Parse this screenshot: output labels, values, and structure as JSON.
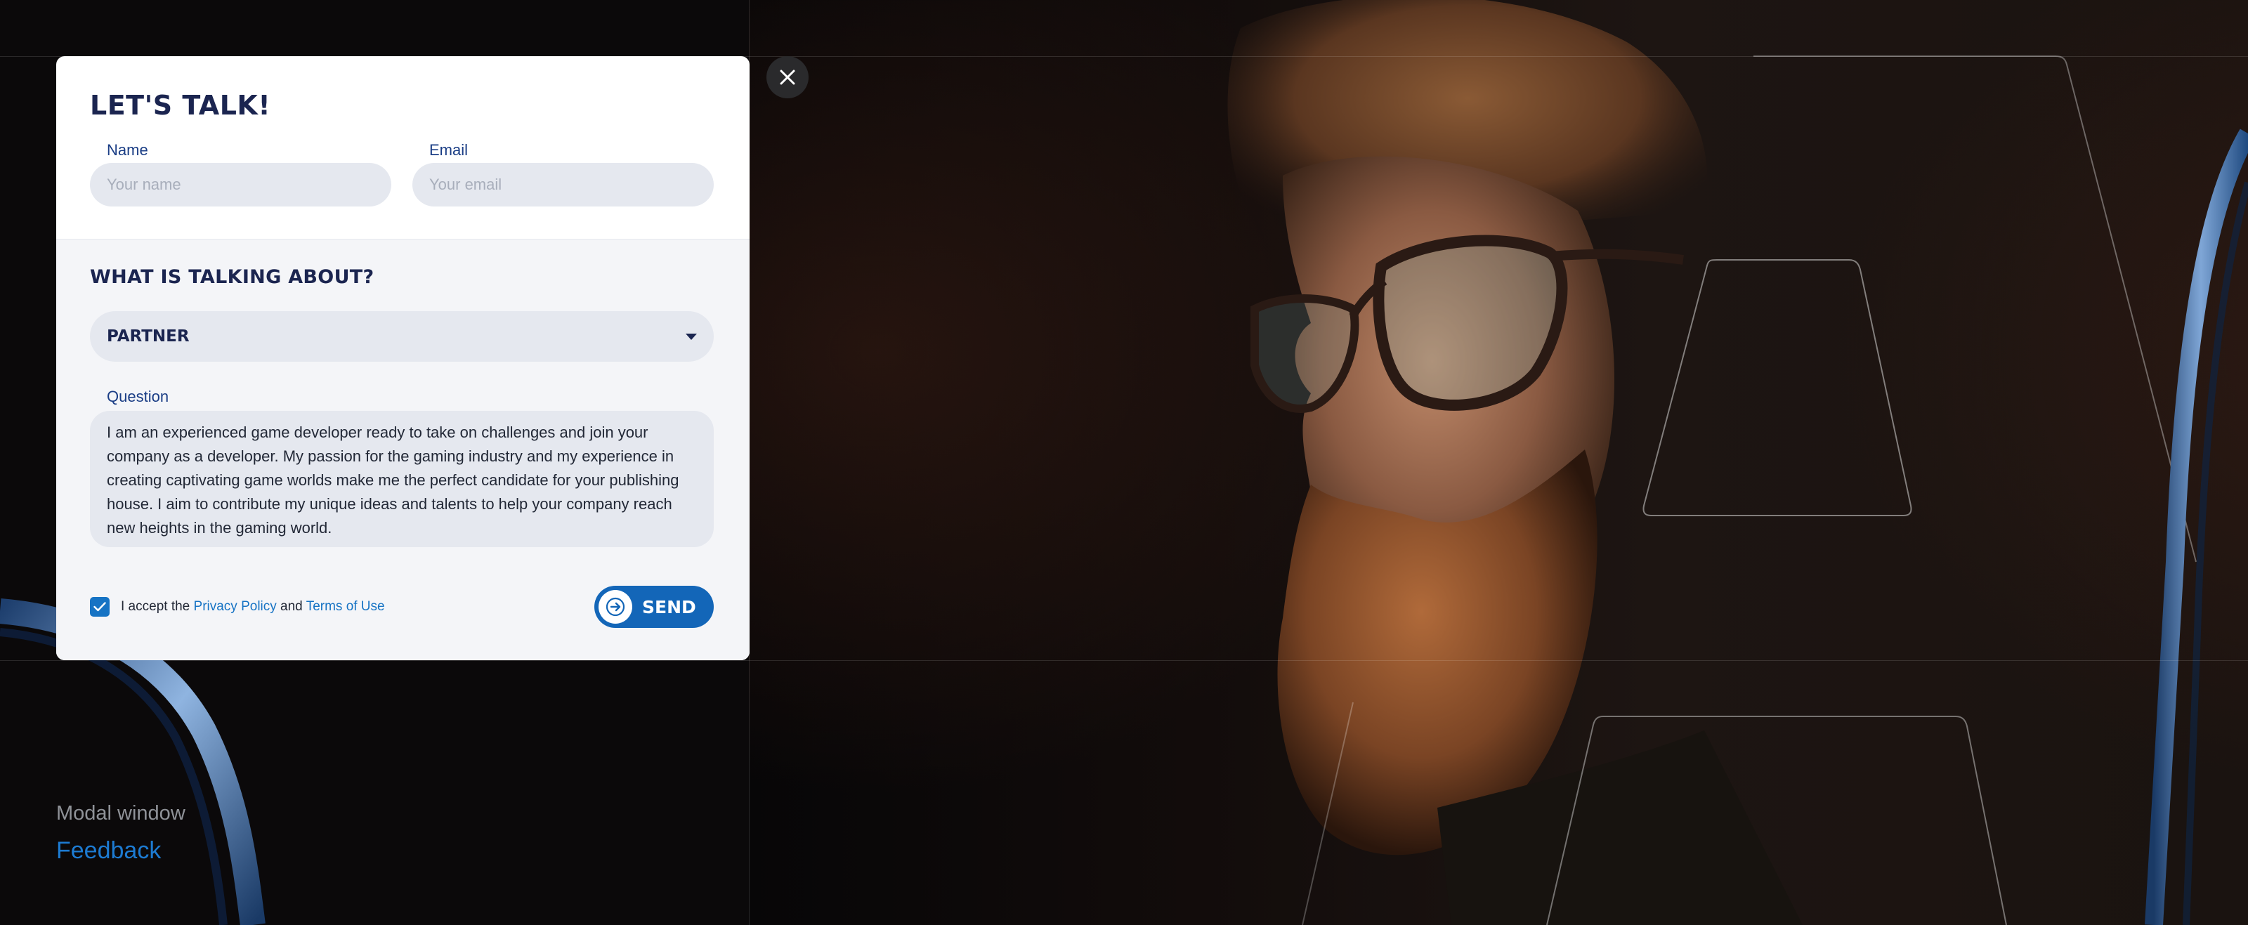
{
  "modal": {
    "title": "LET'S TALK!",
    "name_field": {
      "label": "Name",
      "placeholder": "Your name",
      "value": ""
    },
    "email_field": {
      "label": "Email",
      "placeholder": "Your email",
      "value": ""
    },
    "topic_heading": "WHAT IS TALKING ABOUT?",
    "topic_select": {
      "selected": "PARTNER"
    },
    "question_field": {
      "label": "Question",
      "value": "I am an experienced game developer ready to take on challenges and join your company as a developer. My passion for the gaming industry and my experience in creating captivating game worlds make me the perfect candidate for your publishing house. I aim to contribute my unique ideas and talents to help your company reach new heights in the gaming world."
    },
    "consent": {
      "checked": true,
      "prefix": "I accept the",
      "privacy_link": "Privacy Policy",
      "conjunction": "and",
      "terms_link": "Terms of Use"
    },
    "send_button": {
      "label": "SEND",
      "icon": "arrow-right-icon"
    },
    "close_icon": "close-icon"
  },
  "caption": {
    "kind": "Modal window",
    "name": "Feedback"
  },
  "colors": {
    "accent": "#1673c4",
    "title": "#1b2550",
    "label": "#1a3d85",
    "input_bg": "#e5e8ef",
    "page_bg": "#0b090a"
  }
}
